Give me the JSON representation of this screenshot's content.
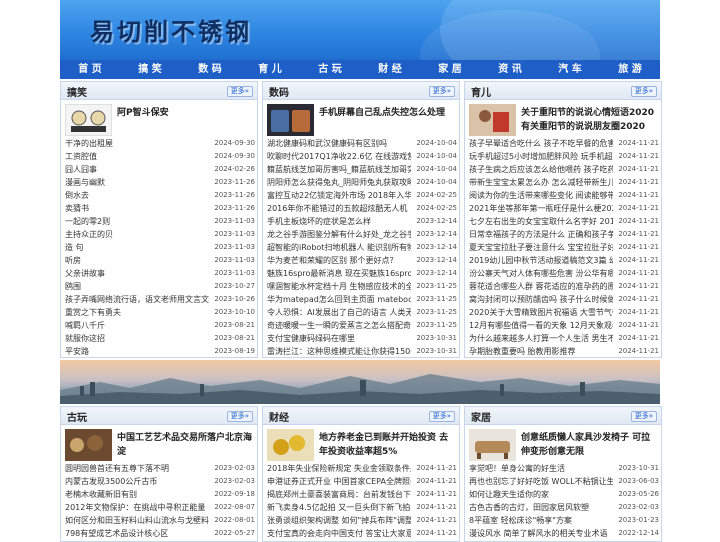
{
  "site": {
    "title": "易切削不锈钢"
  },
  "nav": [
    "首 页",
    "搞 笑",
    "数 码",
    "育 儿",
    "古 玩",
    "财 经",
    "家 居",
    "资 讯",
    "汽 车",
    "旅 游"
  ],
  "more_label": "更多»",
  "panels": [
    {
      "title": "搞笑",
      "featured": "阿P智斗保安",
      "rows": [
        [
          "干净的出租屋",
          "2024-09-30"
        ],
        [
          "工资腔值",
          "2024-09-30"
        ],
        [
          "囧人囧事",
          "2024-02-26"
        ],
        [
          "漫画与幽默",
          "2023-11-26"
        ],
        [
          "倒水去",
          "2023-11-26"
        ],
        [
          "卖猜书",
          "2023-11-26"
        ],
        [
          "一起的零2则",
          "2023-11-03"
        ],
        [
          "主持众正的贝",
          "2023-11-03"
        ],
        [
          "造 句",
          "2023-11-03"
        ],
        [
          "听房",
          "2023-11-03"
        ],
        [
          "父亲讲故事",
          "2023-11-03"
        ],
        [
          "鸥围",
          "2023-10-27"
        ],
        [
          "孩子弄嘴网络流行语，语文老师用文言文回应网",
          "2023-10-26"
        ],
        [
          "重赏之下有勇夫",
          "2023-10-10"
        ],
        [
          "喊羁八千斤",
          "2023-08-21"
        ],
        [
          "就服你这招",
          "2023-08-21"
        ],
        [
          "平安路",
          "2023-08-19"
        ]
      ]
    },
    {
      "title": "数码",
      "featured": "手机屏幕自己乱点失控怎么处理",
      "rows": [
        [
          "湖北健康码和武汉健康码有区别吗",
          "2024-10-04"
        ],
        [
          "吹聊时代2017Q1净收22.6亿 在线游戏营收1.397",
          "2024-10-04"
        ],
        [
          "籍蓝航线芝加哥厉害吗_籍蓝航线芝加哥实用吗_",
          "2024-10-04"
        ],
        [
          "阴阳师怎么获得兔丸_阴阳师兔丸获取攻略_阴阳",
          "2024-10-04"
        ],
        [
          "富控互动22亿锁定海外市场 2018年入华战略大",
          "2024-02-25"
        ],
        [
          "2016年你不能错过的五款超炫酷无人机",
          "2024-02-25"
        ],
        [
          "手机主板烧坏的症状是怎么样",
          "2023-12-14"
        ],
        [
          "龙之谷手游图鉴分解有什么好处_龙之谷手游图",
          "2023-12-14"
        ],
        [
          "超智能的iRobot扫地机器人 能识别所有物体",
          "2023-12-14"
        ],
        [
          "华为麦芒和荣耀的区别 那个更好点？",
          "2023-12-14"
        ],
        [
          "魅族16spro最新消息 现在买魅族16spro划算吗",
          "2023-12-14"
        ],
        [
          "嘿涸智能水杯定档十月 生物感应技术的全新突",
          "2023-11-25"
        ],
        [
          "华为matepad怎么回到主页面 matebook e值得入",
          "2023-11-25"
        ],
        [
          "令人恐惧：AI发展出了自己的语言 人类无法理",
          "2023-11-25"
        ],
        [
          "奇迹暖暖一生一瞬的爱蒸言之怎么搭配奇迹暖暖",
          "2023-11-25"
        ],
        [
          "支付宝健康码绿码在哪里",
          "2023-10-31"
        ],
        [
          "雷涛拦江：这种思维模式能让你获得1500 亿美",
          "2023-10-31"
        ]
      ]
    },
    {
      "title": "育儿",
      "featured": "关于重阳节的说说心情短语2020 有关重阳节的说说朋友圈2020",
      "rows": [
        [
          "孩子早晕适合吃什么 孩子不吃早餐的危害",
          "2024-11-21"
        ],
        [
          "玩手机超过5小时增加肥胖风险 玩手机超过5小",
          "2024-11-21"
        ],
        [
          "孩子生病之后应该怎么给他喂药 孩子吃药要注",
          "2024-11-21"
        ],
        [
          "带新生宝宝太累怎么办 怎么减轻带新生儿的负担",
          "2024-11-21"
        ],
        [
          "阅读为你的生活带来哪些变化 阅读能够带来哪",
          "2024-11-21"
        ],
        [
          "2021年坐等那年第一瓶旺仔是什么梗2021年的",
          "2024-11-21"
        ],
        [
          "七夕左右出生的女宝宝取什么名字好 2018七夕",
          "2024-11-21"
        ],
        [
          "日常幸福孩子的方法是什么 正确和孩子争子的",
          "2024-11-21"
        ],
        [
          "夏天宝宝拉肚子要注意什么 宝宝拉肚子好转迹",
          "2024-11-21"
        ],
        [
          "2019幼儿园中秋节活动报道稿范文3篇 幼儿园中",
          "2024-11-21"
        ],
        [
          "汾公寨天气对人体有哪些危害 汾公华有哪些有",
          "2024-11-21"
        ],
        [
          "蓉花适合哪些人群 蓉花适应的准孕药的原因",
          "2024-11-21"
        ],
        [
          "窝沟封闭可以预防龋齿吗 孩子什么时候做窝沟",
          "2024-11-21"
        ],
        [
          "2020关于大雪精致图片祝福语 大雪节气带字图",
          "2024-11-21"
        ],
        [
          "12月有哪些值得一看的天象 12月天象观看指南",
          "2024-11-21"
        ],
        [
          "为什么越来越多人打算一个人生活 男生不结婚",
          "2024-11-21"
        ],
        [
          "孕期胎教重要吗 胎教用影推荐",
          "2024-11-21"
        ]
      ]
    },
    {
      "title": "古玩",
      "featured": "中国工艺艺术品交易所落户北京海淀",
      "rows": [
        [
          "圆明园兽首还有五尊下落不明",
          "2023-02-03"
        ],
        [
          "内蒙古发现3500公斤古币",
          "2023-02-03"
        ],
        [
          "老楠木收藏新旧有别",
          "2022-09-18"
        ],
        [
          "2012年文物保护：在挑战中寻积正能量",
          "2022-08-07"
        ],
        [
          "如何区分和田玉籽料山料山流水与戈壁料",
          "2022-08-01"
        ],
        [
          "798有望成艺术品设计核心区",
          "2022-05-27"
        ]
      ]
    },
    {
      "title": "财经",
      "featured": "地方养老金已到账并开始投资 去年投资收益率超5%",
      "rows": [
        [
          "2018年失业保险新规定 失业金领取条件是什么",
          "2024-11-21"
        ],
        [
          "申港证券正式开业 中国首家CEPA全牌照券商",
          "2024-11-21"
        ],
        [
          "揭底郑州土豪喜装富商局：台前发钱台下财务",
          "2024-11-21"
        ],
        [
          "新飞卖身4.5亿起拍 又一巨头倒下新飞拍卖花落",
          "2024-11-21"
        ],
        [
          "张勇谈组织架构调整 如何\"掉兵布阵\"调整战略",
          "2024-11-21"
        ],
        [
          "支付宝真的会走向中国支付 答宝让大家意想不",
          "2024-11-21"
        ]
      ]
    },
    {
      "title": "家居",
      "featured": "创意纸质懒人家具沙发椅子 可拉伸变形创意无限",
      "rows": [
        [
          "享觉吧！单身公寓的好生活",
          "2023-10-31"
        ],
        [
          "再也也别忘了好好吃饭 WOLL不粘锅让生活更",
          "2023-06-03"
        ],
        [
          "如何让趣天生适你的家",
          "2023-05-26"
        ],
        [
          "古色古香的古灯，田园家居风软塑",
          "2023-02-03"
        ],
        [
          "8平蕴室 轻松床诊\"畅享\"方案",
          "2023-01-23"
        ],
        [
          "漫设风水 简单了解风水的相关专业术语",
          "2022-12-14"
        ]
      ]
    }
  ]
}
